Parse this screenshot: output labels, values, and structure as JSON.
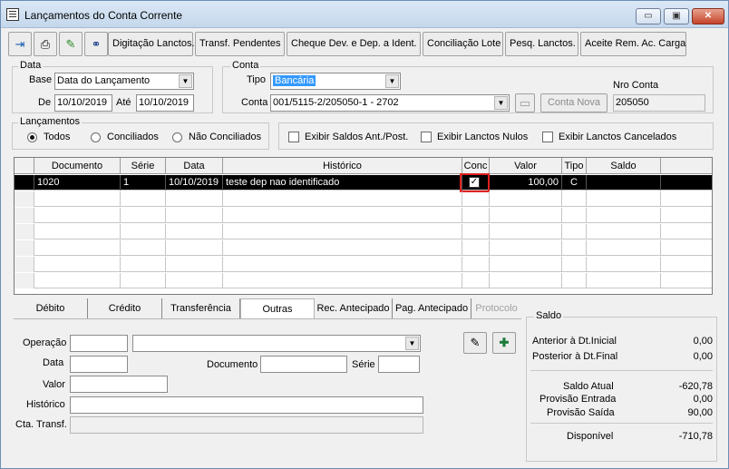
{
  "window": {
    "title": "Lançamentos do Conta Corrente",
    "min": "▭",
    "max": "▣",
    "close": "✕"
  },
  "toolbar": {
    "icons": [
      "exit-icon",
      "print-icon",
      "eraser-icon",
      "binoculars-icon"
    ],
    "buttons": [
      "Digitação Lanctos.",
      "Transf. Pendentes",
      "Cheque Dev. e Dep. a Ident.",
      "Conciliação Lote",
      "Pesq. Lanctos.",
      "Aceite Rem. Ac. Carga"
    ]
  },
  "data_group": {
    "title": "Data",
    "base_label": "Base",
    "base_value": "Data do Lançamento",
    "de_label": "De",
    "de_value": "10/10/2019",
    "ate_label": "Até",
    "ate_value": "10/10/2019"
  },
  "conta_group": {
    "title": "Conta",
    "tipo_label": "Tipo",
    "tipo_value": "Bancária",
    "conta_label": "Conta",
    "conta_value": "001/5115-2/205050-1 - 2702",
    "nova_button": "Conta Nova",
    "nro_label": "Nro Conta",
    "nro_value": "205050"
  },
  "lanc_group": {
    "title": "Lançamentos",
    "options": [
      "Todos",
      "Conciliados",
      "Não Conciliados"
    ],
    "selected": 0
  },
  "options_group": {
    "checks": [
      "Exibir Saldos Ant./Post.",
      "Exibir Lanctos  Nulos",
      "Exibir Lanctos  Cancelados"
    ]
  },
  "grid": {
    "columns": [
      "Documento",
      "Série",
      "Data",
      "Histórico",
      "Conc",
      "Valor",
      "Tipo",
      "Saldo"
    ],
    "rows": [
      {
        "documento": "1020",
        "serie": "1",
        "data": "10/10/2019",
        "historico": "teste dep nao identificado",
        "conc": true,
        "valor": "100,00",
        "tipo": "C",
        "saldo": ""
      }
    ]
  },
  "tabs": [
    "Débito",
    "Crédito",
    "Transferência",
    "Outras",
    "Rec. Antecipado",
    "Pag. Antecipado",
    "Protocolo"
  ],
  "active_tab": 3,
  "form": {
    "operacao_label": "Operação",
    "data_label": "Data",
    "documento_label": "Documento",
    "serie_label": "Série",
    "valor_label": "Valor",
    "historico_label": "Histórico",
    "cta_label": "Cta. Transf."
  },
  "saldo": {
    "title": "Saldo",
    "anterior_label": "Anterior à Dt.Inicial",
    "anterior_value": "0,00",
    "posterior_label": "Posterior à Dt.Final",
    "posterior_value": "0,00",
    "atual_label": "Saldo Atual",
    "atual_value": "-620,78",
    "prov_entrada_label": "Provisão Entrada",
    "prov_entrada_value": "0,00",
    "prov_saida_label": "Provisão Saída",
    "prov_saida_value": "90,00",
    "disponivel_label": "Disponível",
    "disponivel_value": "-710,78"
  },
  "colors": {
    "title_bar": "#c4d7ec",
    "selected_row": "#000000",
    "highlight": "#e02020",
    "combo_selection": "#3399ff"
  }
}
